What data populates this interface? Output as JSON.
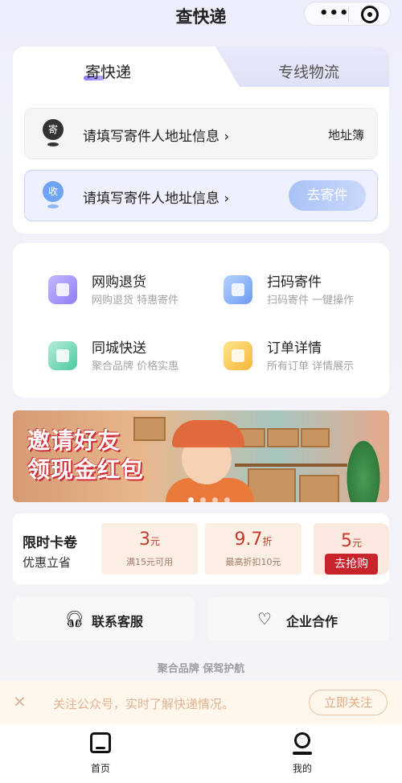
{
  "header": {
    "title": "查快递",
    "more_icon": "more-dots-icon",
    "close_icon": "target-icon"
  },
  "tabs": [
    {
      "label": "寄快递",
      "active": true
    },
    {
      "label": "专线物流",
      "active": false
    }
  ],
  "sender": {
    "badge": "寄",
    "text": "请填写寄件人地址信息 ›",
    "address_book": "地址簿"
  },
  "receiver": {
    "badge": "收",
    "text": "请填写寄件人地址信息 ›",
    "button": "去寄件"
  },
  "services": [
    {
      "name": "网购退货",
      "desc": "网购退货 特惠寄件",
      "icon": "return-bag-icon"
    },
    {
      "name": "扫码寄件",
      "desc": "扫码寄件 一键操作",
      "icon": "scan-icon"
    },
    {
      "name": "同城快送",
      "desc": "聚合品牌 价格实惠",
      "icon": "city-delivery-icon"
    },
    {
      "name": "订单详情",
      "desc": "所有订单 详情展示",
      "icon": "order-icon"
    }
  ],
  "banner": {
    "line1": "邀请好友",
    "line2": "领现金红包"
  },
  "coupons": {
    "title": "限时卡卷",
    "subtitle": "优惠立省",
    "items": [
      {
        "value": "3",
        "unit": "元",
        "condition": "满15元可用"
      },
      {
        "value": "9.7",
        "unit": "折",
        "condition": "最高折扣10元"
      },
      {
        "value": "5",
        "unit": "元",
        "button": "去抢购"
      }
    ]
  },
  "contact": {
    "service": "联系客服",
    "cooperation": "企业合作"
  },
  "slogan": "聚合品牌 保驾护航",
  "follow": {
    "text": "关注公众号，实时了解快递情况。",
    "button": "立即关注"
  },
  "tabbar": [
    {
      "label": "首页"
    },
    {
      "label": "我的"
    }
  ],
  "colors": {
    "accent": "#8a7cf0",
    "coupon_red": "#c7242c",
    "receiver_border": "#c9d3f7"
  }
}
